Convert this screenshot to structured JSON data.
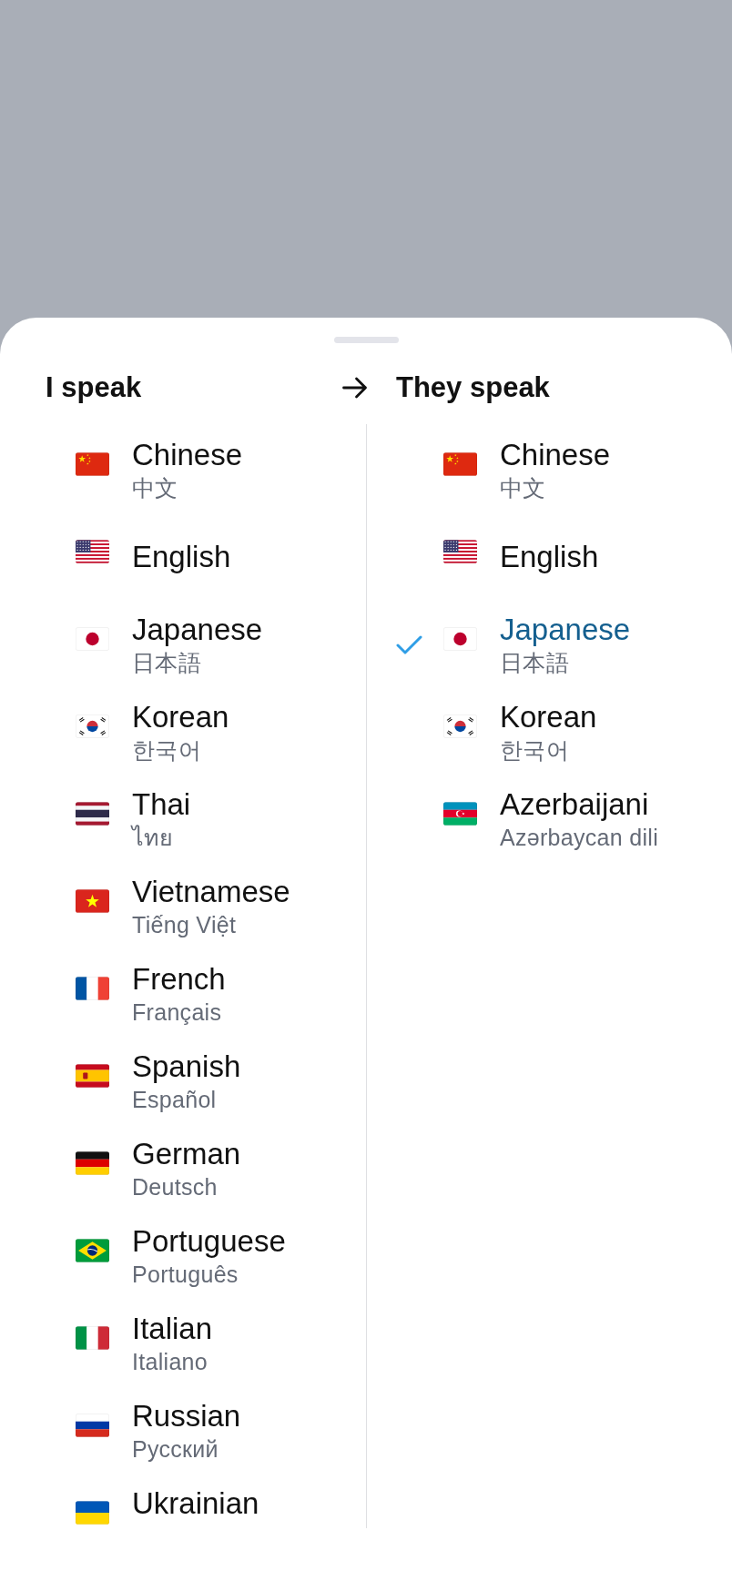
{
  "header": {
    "source_heading": "I speak",
    "target_heading": "They speak"
  },
  "source_languages": [
    {
      "kind": "china",
      "name": "Chinese",
      "native": "中文",
      "selected": false,
      "clipped": false
    },
    {
      "kind": "usa",
      "name": "English",
      "selected": false,
      "clipped": false
    },
    {
      "kind": "japan",
      "name": "Japanese",
      "native": "日本語",
      "selected": false,
      "clipped": false
    },
    {
      "kind": "korea",
      "name": "Korean",
      "native": "한국어",
      "selected": false,
      "clipped": false
    },
    {
      "kind": "thailand",
      "name": "Thai",
      "native": "ไทย",
      "selected": false,
      "clipped": false
    },
    {
      "kind": "vietnam",
      "name": "Vietnamese",
      "native": "Tiếng Việt",
      "selected": false,
      "clipped": false
    },
    {
      "kind": "france",
      "name": "French",
      "native": "Français",
      "selected": false,
      "clipped": false
    },
    {
      "kind": "spain",
      "name": "Spanish",
      "native": "Español",
      "selected": false,
      "clipped": false
    },
    {
      "kind": "germany",
      "name": "German",
      "native": "Deutsch",
      "selected": false,
      "clipped": false
    },
    {
      "kind": "brazil",
      "name": "Portuguese",
      "native": "Português",
      "selected": false,
      "clipped": false
    },
    {
      "kind": "italy",
      "name": "Italian",
      "native": "Italiano",
      "selected": false,
      "clipped": false
    },
    {
      "kind": "russia",
      "name": "Russian",
      "native": "Русский",
      "selected": false,
      "clipped": false
    },
    {
      "kind": "ukraine",
      "name": "Ukrainian",
      "selected": false,
      "clipped": true
    }
  ],
  "target_languages": [
    {
      "kind": "china",
      "name": "Chinese",
      "native": "中文",
      "selected": false,
      "clipped": false
    },
    {
      "kind": "usa",
      "name": "English",
      "selected": false,
      "clipped": false
    },
    {
      "kind": "japan",
      "name": "Japanese",
      "native": "日本語",
      "selected": true,
      "clipped": false
    },
    {
      "kind": "korea",
      "name": "Korean",
      "native": "한국어",
      "selected": false,
      "clipped": false
    },
    {
      "kind": "azerbaijan",
      "name": "Azerbaijani",
      "native": "Azərbaycan dili",
      "selected": false,
      "clipped": false
    }
  ]
}
